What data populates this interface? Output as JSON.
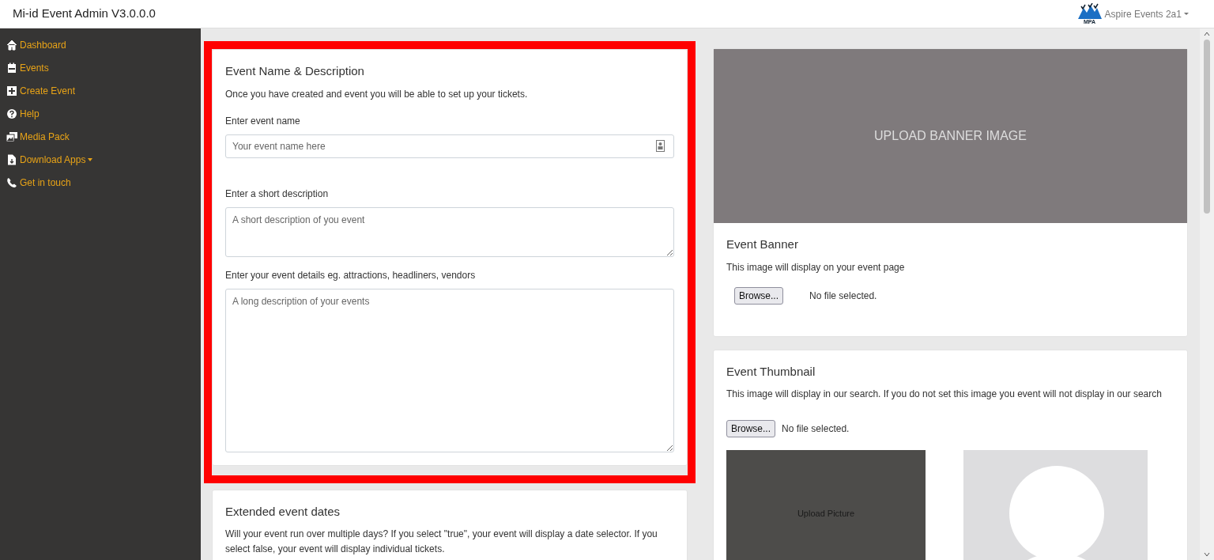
{
  "app_title": "Mi-id Event Admin V3.0.0.0",
  "account": {
    "logo_text": "MPA",
    "name": "Aspire Events 2a1"
  },
  "sidebar": {
    "items": [
      {
        "kind": "home",
        "label": "Dashboard",
        "dropdown": false
      },
      {
        "kind": "calendar",
        "label": "Events",
        "dropdown": false
      },
      {
        "kind": "plus",
        "label": "Create Event",
        "dropdown": false
      },
      {
        "kind": "help",
        "label": "Help",
        "dropdown": false
      },
      {
        "kind": "images",
        "label": "Media Pack",
        "dropdown": false
      },
      {
        "kind": "file",
        "label": "Download Apps",
        "dropdown": true
      },
      {
        "kind": "phone",
        "label": "Get in touch",
        "dropdown": false
      }
    ]
  },
  "event_card": {
    "highlighted": true,
    "title": "Event Name & Description",
    "intro": "Once you have created and event you will be able to set up your tickets.",
    "fields": [
      {
        "kind": "text",
        "label": "Enter event name",
        "placeholder": "Your event name here"
      },
      {
        "kind": "short_area",
        "label": "Enter a short description",
        "placeholder": "A short description of you event"
      },
      {
        "kind": "long_area",
        "label": "Enter your event details eg. attractions, headliners, vendors",
        "placeholder": "A long description of your events"
      }
    ]
  },
  "dates_card": {
    "title": "Extended event dates",
    "text": "Will your event run over multiple days? If you select \"true\", your event will display a date selector. If you select false, your event will display individual tickets."
  },
  "banner_card": {
    "image_text": "UPLOAD BANNER IMAGE",
    "title": "Event Banner",
    "text": "This image will display on your event page",
    "browse": "Browse...",
    "file_status": "No file selected."
  },
  "thumbnail_card": {
    "title": "Event Thumbnail",
    "text": "This image will display in our search. If you do not set this image you event will not display in our search",
    "browse": "Browse...",
    "file_status": "No file selected.",
    "upload_text": "Upload Picture"
  }
}
